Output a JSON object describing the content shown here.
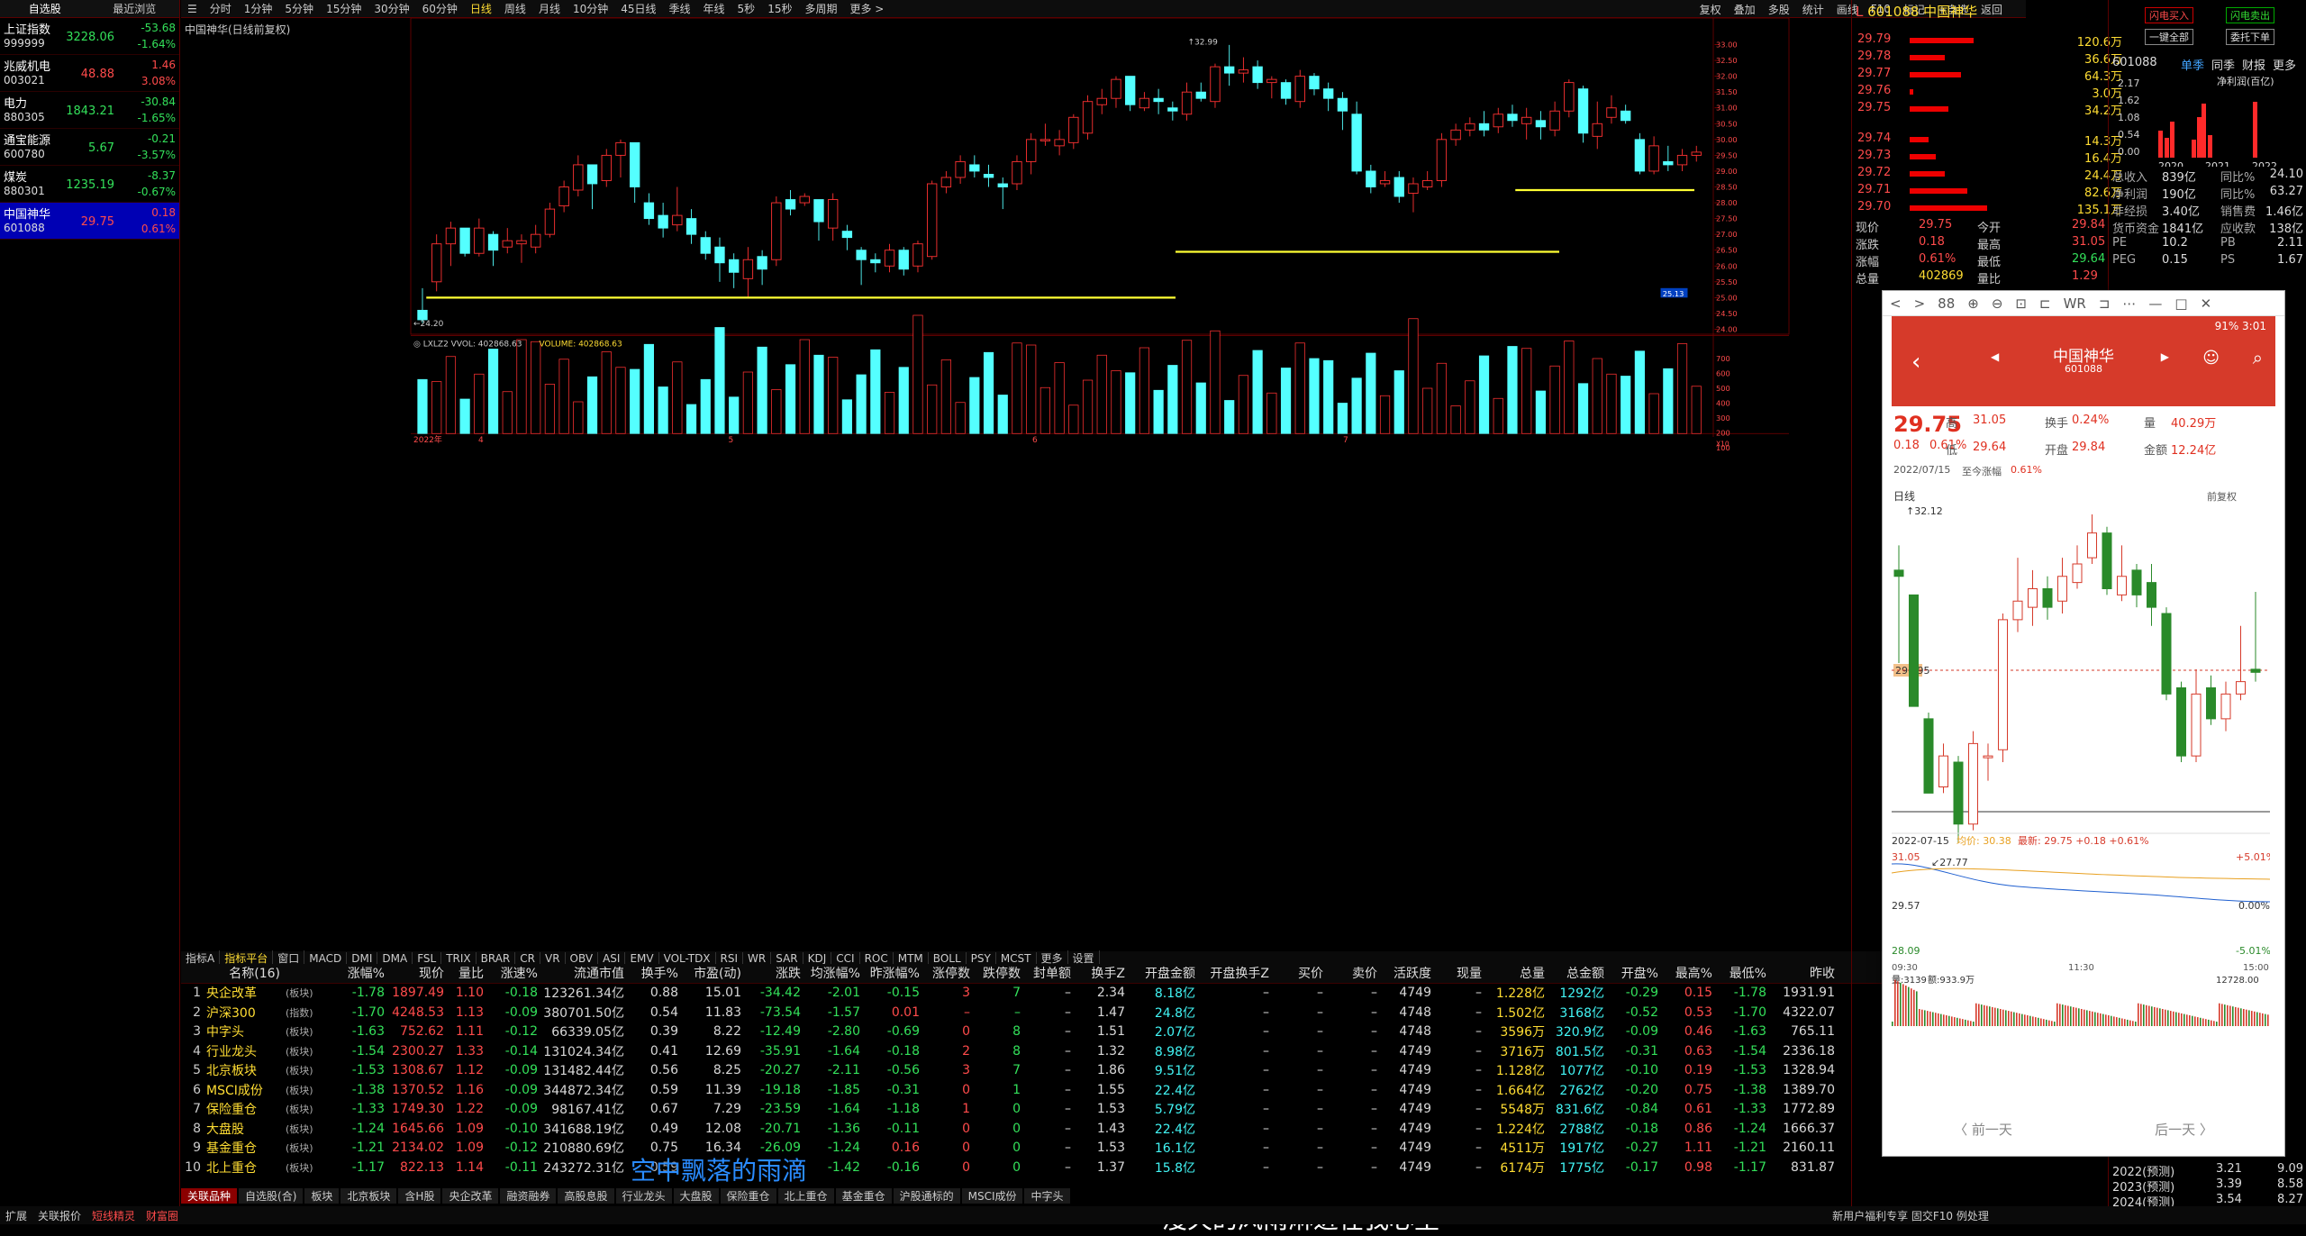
{
  "watchlist": {
    "tab_left": "自选股",
    "tab_right": "最近浏览",
    "items": [
      {
        "name": "上证指数",
        "code": "999999",
        "price": "3228.06",
        "chg": "-53.68",
        "pct": "-1.64%",
        "color": "grn"
      },
      {
        "name": "兆威机电",
        "code": "003021",
        "price": "48.88",
        "chg": "1.46",
        "pct": "3.08%",
        "color": "red"
      },
      {
        "name": "电力",
        "code": "880305",
        "price": "1843.21",
        "chg": "-30.84",
        "pct": "-1.65%",
        "color": "grn"
      },
      {
        "name": "通宝能源",
        "code": "600780",
        "price": "5.67",
        "chg": "-0.21",
        "pct": "-3.57%",
        "color": "grn"
      },
      {
        "name": "煤炭",
        "code": "880301",
        "price": "1235.19",
        "chg": "-8.37",
        "pct": "-0.67%",
        "color": "grn"
      },
      {
        "name": "中国神华",
        "code": "601088",
        "price": "29.75",
        "chg": "0.18",
        "pct": "0.61%",
        "color": "red",
        "selected": true
      }
    ]
  },
  "toolbar": {
    "items": [
      "分时",
      "1分钟",
      "5分钟",
      "15分钟",
      "30分钟",
      "60分钟",
      "日线",
      "周线",
      "月线",
      "10分钟",
      "45日线",
      "季线",
      "年线",
      "5秒",
      "15秒",
      "多周期",
      "更多 >"
    ],
    "active": "日线",
    "right": [
      "复权",
      "叠加",
      "多股",
      "统计",
      "画线",
      "F10",
      "标记",
      "+自选",
      "返回"
    ]
  },
  "chart": {
    "title": "中国神华(日线前复权)",
    "high_label": "32.99",
    "low_label": "←24.20",
    "price_ticks": [
      "33.00",
      "32.50",
      "32.00",
      "31.50",
      "31.00",
      "30.50",
      "30.00",
      "29.50",
      "29.00",
      "28.50",
      "28.00",
      "27.50",
      "27.00",
      "26.50",
      "26.00",
      "25.50",
      "25.00",
      "24.50",
      "24.00"
    ],
    "current_tag": "25.13",
    "months": [
      "2022年",
      "4",
      "5",
      "6",
      "7"
    ],
    "vol_title": "LXLZ2 VVOL: 402868.63",
    "vol_value": "VOLUME: 402868.63",
    "vol_ticks": [
      "700",
      "600",
      "500",
      "400",
      "300",
      "200",
      "100"
    ],
    "vol_unit": "X10"
  },
  "indicator_tabs": [
    "指标A",
    "指标平台",
    "窗口",
    "MACD",
    "DMI",
    "DMA",
    "FSL",
    "TRIX",
    "BRAR",
    "CR",
    "VR",
    "OBV",
    "ASI",
    "EMV",
    "VOL-TDX",
    "RSI",
    "WR",
    "SAR",
    "KDJ",
    "CCI",
    "ROC",
    "MTM",
    "BOLL",
    "PSY",
    "MCST",
    "更多",
    "设置"
  ],
  "table": {
    "headers": [
      "",
      "名称(16)",
      "",
      "涨幅%",
      "现价",
      "量比",
      "涨速%",
      "流通市值",
      "换手%",
      "市盈(动)",
      "涨跌",
      "均涨幅%",
      "昨涨幅%",
      "涨停数",
      "跌停数",
      "封单额",
      "换手Z",
      "开盘金额",
      "开盘换手Z",
      "买价",
      "卖价",
      "活跃度",
      "现量",
      "总量",
      "总金额",
      "开盘%",
      "最高%",
      "最低%",
      "昨收"
    ],
    "rows": [
      [
        "1",
        "央企改革",
        "(板块)",
        "-1.78",
        "1897.49",
        "1.10",
        "-0.18",
        "123261.34亿",
        "0.88",
        "15.01",
        "-34.42",
        "-2.01",
        "-0.15",
        "3",
        "7",
        "–",
        "2.34",
        "8.18亿",
        "–",
        "–",
        "–",
        "4749",
        "–",
        "1.228亿",
        "1292亿",
        "-0.29",
        "0.15",
        "-1.78",
        "1931.91"
      ],
      [
        "2",
        "沪深300",
        "(指数)",
        "-1.70",
        "4248.53",
        "1.13",
        "-0.09",
        "380701.50亿",
        "0.54",
        "11.83",
        "-73.54",
        "-1.57",
        "0.01",
        "–",
        "–",
        "–",
        "1.47",
        "24.8亿",
        "–",
        "–",
        "–",
        "4748",
        "–",
        "1.502亿",
        "3168亿",
        "-0.52",
        "0.53",
        "-1.70",
        "4322.07"
      ],
      [
        "3",
        "中字头",
        "(板块)",
        "-1.63",
        "752.62",
        "1.11",
        "-0.12",
        "66339.05亿",
        "0.39",
        "8.22",
        "-12.49",
        "-2.80",
        "-0.69",
        "0",
        "8",
        "–",
        "1.51",
        "2.07亿",
        "–",
        "–",
        "–",
        "4748",
        "–",
        "3596万",
        "320.9亿",
        "-0.09",
        "0.46",
        "-1.63",
        "765.11"
      ],
      [
        "4",
        "行业龙头",
        "(板块)",
        "-1.54",
        "2300.27",
        "1.33",
        "-0.14",
        "131024.34亿",
        "0.41",
        "12.69",
        "-35.91",
        "-1.64",
        "-0.18",
        "2",
        "8",
        "–",
        "1.32",
        "8.98亿",
        "–",
        "–",
        "–",
        "4749",
        "–",
        "3716万",
        "801.5亿",
        "-0.31",
        "0.63",
        "-1.54",
        "2336.18"
      ],
      [
        "5",
        "北京板块",
        "(板块)",
        "-1.53",
        "1308.67",
        "1.12",
        "-0.09",
        "131482.44亿",
        "0.56",
        "8.25",
        "-20.27",
        "-2.11",
        "-0.56",
        "3",
        "7",
        "–",
        "1.86",
        "9.51亿",
        "–",
        "–",
        "–",
        "4749",
        "–",
        "1.128亿",
        "1077亿",
        "-0.10",
        "0.19",
        "-1.53",
        "1328.94"
      ],
      [
        "6",
        "MSCI成份",
        "(板块)",
        "-1.38",
        "1370.52",
        "1.16",
        "-0.09",
        "344872.34亿",
        "0.59",
        "11.39",
        "-19.18",
        "-1.85",
        "-0.31",
        "0",
        "1",
        "–",
        "1.55",
        "22.4亿",
        "–",
        "–",
        "–",
        "4749",
        "–",
        "1.664亿",
        "2762亿",
        "-0.20",
        "0.75",
        "-1.38",
        "1389.70"
      ],
      [
        "7",
        "保险重仓",
        "(板块)",
        "-1.33",
        "1749.30",
        "1.22",
        "-0.09",
        "98167.41亿",
        "0.67",
        "7.29",
        "-23.59",
        "-1.64",
        "-1.18",
        "1",
        "0",
        "–",
        "1.53",
        "5.79亿",
        "–",
        "–",
        "–",
        "4749",
        "–",
        "5548万",
        "831.6亿",
        "-0.84",
        "0.61",
        "-1.33",
        "1772.89"
      ],
      [
        "8",
        "大盘股",
        "(板块)",
        "-1.24",
        "1645.66",
        "1.09",
        "-0.10",
        "341688.19亿",
        "0.49",
        "12.08",
        "-20.71",
        "-1.36",
        "-0.11",
        "0",
        "0",
        "–",
        "1.43",
        "22.4亿",
        "–",
        "–",
        "–",
        "4749",
        "–",
        "1.224亿",
        "2788亿",
        "-0.18",
        "0.86",
        "-1.24",
        "1666.37"
      ],
      [
        "9",
        "基金重仓",
        "(板块)",
        "-1.21",
        "2134.02",
        "1.09",
        "-0.12",
        "210880.69亿",
        "0.75",
        "16.34",
        "-26.09",
        "-1.24",
        "0.16",
        "0",
        "0",
        "–",
        "1.53",
        "16.1亿",
        "–",
        "–",
        "–",
        "4749",
        "–",
        "4511万",
        "1917亿",
        "-0.27",
        "1.11",
        "-1.21",
        "2160.11"
      ],
      [
        "10",
        "北上重仓",
        "(板块)",
        "-1.17",
        "822.13",
        "1.14",
        "-0.11",
        "243272.31亿",
        "0.59",
        "–",
        "–",
        "-1.42",
        "-0.16",
        "0",
        "0",
        "–",
        "1.37",
        "15.8亿",
        "–",
        "–",
        "–",
        "4749",
        "–",
        "6174万",
        "1775亿",
        "-0.17",
        "0.98",
        "-1.17",
        "831.87"
      ]
    ]
  },
  "bottom_tabs": [
    "关联品种",
    "自选股(合)",
    "板块",
    "北京板块",
    "含H股",
    "央企改革",
    "融资融券",
    "高股息股",
    "行业龙头",
    "大盘股",
    "保险重仓",
    "北上重仓",
    "基金重仓",
    "沪股通标的",
    "MSCI成份",
    "中字头"
  ],
  "bottom_tabs2": [
    "扩展",
    "关联报价",
    "短线精灵",
    "财富圈"
  ],
  "quote": {
    "code_name": "601088 中国神华",
    "prefix": "L",
    "asks": [
      [
        "29.79",
        "120.6万"
      ],
      [
        "29.78",
        "36.6万"
      ],
      [
        "29.77",
        "64.3万"
      ],
      [
        "29.76",
        "3.0万"
      ],
      [
        "29.75",
        "34.2万"
      ]
    ],
    "bids": [
      [
        "29.74",
        "14.3万"
      ],
      [
        "29.73",
        "16.4万"
      ],
      [
        "29.72",
        "24.4万"
      ],
      [
        "29.71",
        "82.6万"
      ],
      [
        "29.70",
        "135.1万"
      ]
    ],
    "stats": [
      [
        "现价",
        "29.75",
        "今开",
        "29.84"
      ],
      [
        "涨跌",
        "0.18",
        "最高",
        "31.05"
      ],
      [
        "涨幅",
        "0.61%",
        "最低",
        "29.64"
      ],
      [
        "总量",
        "402869",
        "量比",
        "1.29"
      ]
    ]
  },
  "info": {
    "btn1": "闪电买入",
    "btn2": "闪电卖出",
    "btn3": "一键全部",
    "btn4": "委托下单",
    "code": "601088",
    "tabs": [
      "单季",
      "同季",
      "财报",
      "更多"
    ],
    "chart_label": "净利润(百亿)",
    "years": [
      "2020",
      "2021",
      "2022"
    ],
    "yticks": [
      "2.17",
      "1.62",
      "1.08",
      "0.54",
      "0.00"
    ],
    "fin": [
      [
        "总收入",
        "839亿",
        "同比%",
        "24.10"
      ],
      [
        "净利润",
        "190亿",
        "同比%",
        "63.27"
      ],
      [
        "非经损",
        "3.40亿",
        "销售费",
        "1.46亿"
      ],
      [
        "货币资金",
        "1841亿",
        "应收款",
        "138亿"
      ],
      [
        "PE",
        "10.2",
        "PB",
        "2.11"
      ],
      [
        "PEG",
        "0.15",
        "PS",
        "1.67"
      ]
    ],
    "forecast": [
      [
        "2022(预测)",
        "3.21",
        "9.09"
      ],
      [
        "2023(预测)",
        "3.39",
        "8.58"
      ],
      [
        "2024(预测)",
        "3.54",
        "8.27"
      ]
    ]
  },
  "phone": {
    "browser_icons": [
      "<",
      ">",
      "88",
      "⊕",
      "⊖",
      "⊡",
      "⊏",
      "WR",
      "⊐",
      "⋯",
      "—",
      "□",
      "✕"
    ],
    "status": "91% 3:01",
    "title": "中国神华",
    "code": "601088",
    "price": "29.75",
    "chg": "0.18",
    "pct": "0.61%",
    "high_l": "高",
    "high": "31.05",
    "turn_l": "换手",
    "turn": "0.24%",
    "vol_l": "量",
    "vol": "40.29万",
    "low_l": "低",
    "low": "29.64",
    "open_l": "开盘",
    "open": "29.84",
    "amt_l": "金额",
    "amt": "12.24亿",
    "date": "2022/07/15",
    "since_l": "至今涨幅",
    "since": "0.61%",
    "kline_l": "日线",
    "fq": "前复权",
    "k_high": "32.12",
    "k_tag": "29.795",
    "k_low": "27.77",
    "mini_date": "2022-07-15",
    "mini_avg": "均价: 30.38",
    "mini_latest": "最新: 29.75 +0.18 +0.61%",
    "m_hi": "31.05",
    "m_hip": "+5.01%",
    "m_mid": "29.57",
    "m_midp": "0.00%",
    "m_lo": "28.09",
    "m_lop": "-5.01%",
    "m_t1": "09:30",
    "m_t2": "11:30",
    "m_t3": "15:00",
    "m_vol": "量:3139",
    "m_volv": "额:933.9万",
    "m_vmax": "12728.00",
    "prev": "〈 前一天",
    "next": "后一天 〉"
  },
  "subtitle1": "空中飘落的雨滴",
  "subtitle2": "漫天的风雨淋进在我心里",
  "statusbar": "新用户福利专享 固交F10 例处理"
}
